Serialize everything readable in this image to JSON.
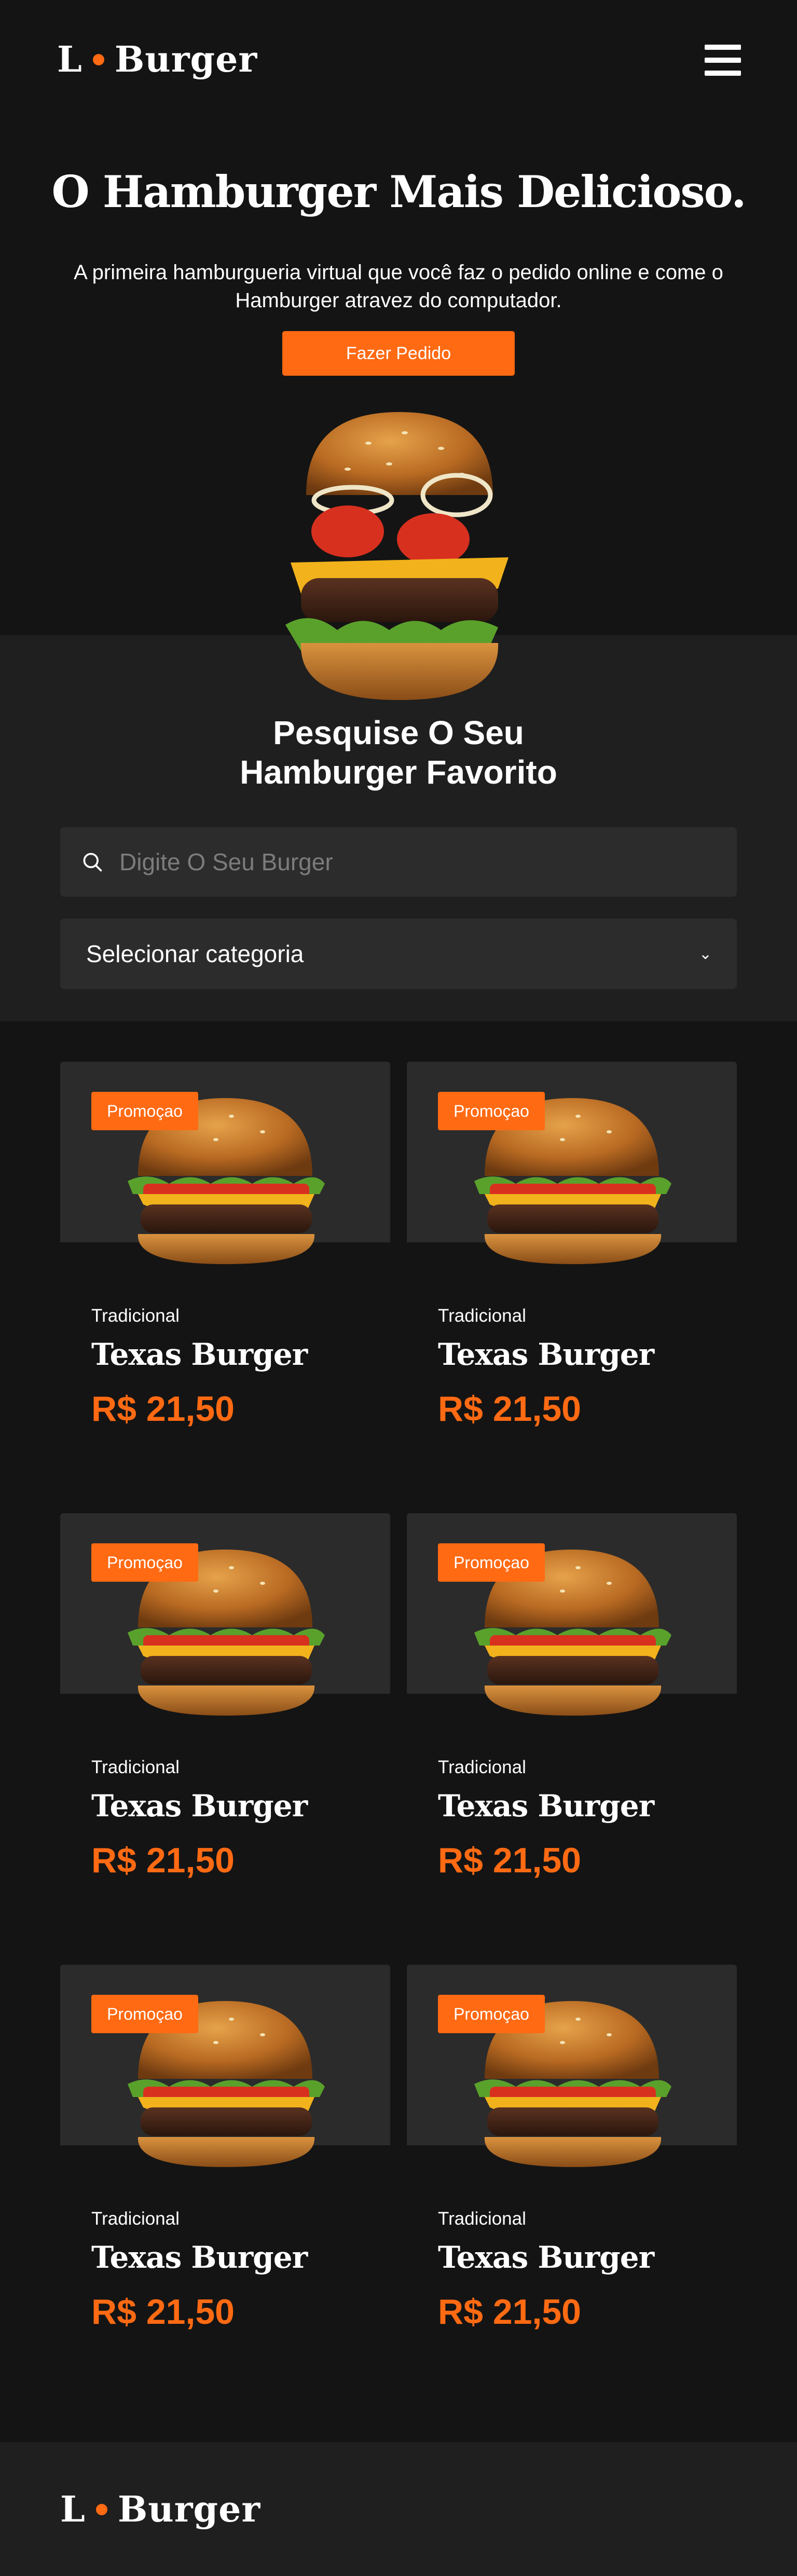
{
  "brand": {
    "logo_left": "L",
    "logo_right": "Burger",
    "accent_color": "#ff6a13"
  },
  "header": {
    "menu_icon": "hamburger-menu-icon"
  },
  "hero": {
    "title": "O Hamburger Mais Delicioso.",
    "subtitle": "A primeira hamburgueria virtual que você faz o pedido online e come o Hamburger atravez do computador.",
    "cta_label": "Fazer Pedido"
  },
  "search": {
    "title_line1": "Pesquise O Seu",
    "title_line2": "Hamburger Favorito",
    "placeholder": "Digite O Seu Burger",
    "category_label": "Selecionar categoria"
  },
  "products": [
    {
      "badge": "Promoçao",
      "category": "Tradicional",
      "name": "Texas Burger",
      "price": "R$ 21,50"
    },
    {
      "badge": "Promoçao",
      "category": "Tradicional",
      "name": "Texas Burger",
      "price": "R$ 21,50"
    },
    {
      "badge": "Promoçao",
      "category": "Tradicional",
      "name": "Texas Burger",
      "price": "R$ 21,50"
    },
    {
      "badge": "Promoçao",
      "category": "Tradicional",
      "name": "Texas Burger",
      "price": "R$ 21,50"
    },
    {
      "badge": "Promoçao",
      "category": "Tradicional",
      "name": "Texas Burger",
      "price": "R$ 21,50"
    },
    {
      "badge": "Promoçao",
      "category": "Tradicional",
      "name": "Texas Burger",
      "price": "R$ 21,50"
    }
  ],
  "footer": {
    "logo_left": "L",
    "logo_right": "Burger"
  }
}
